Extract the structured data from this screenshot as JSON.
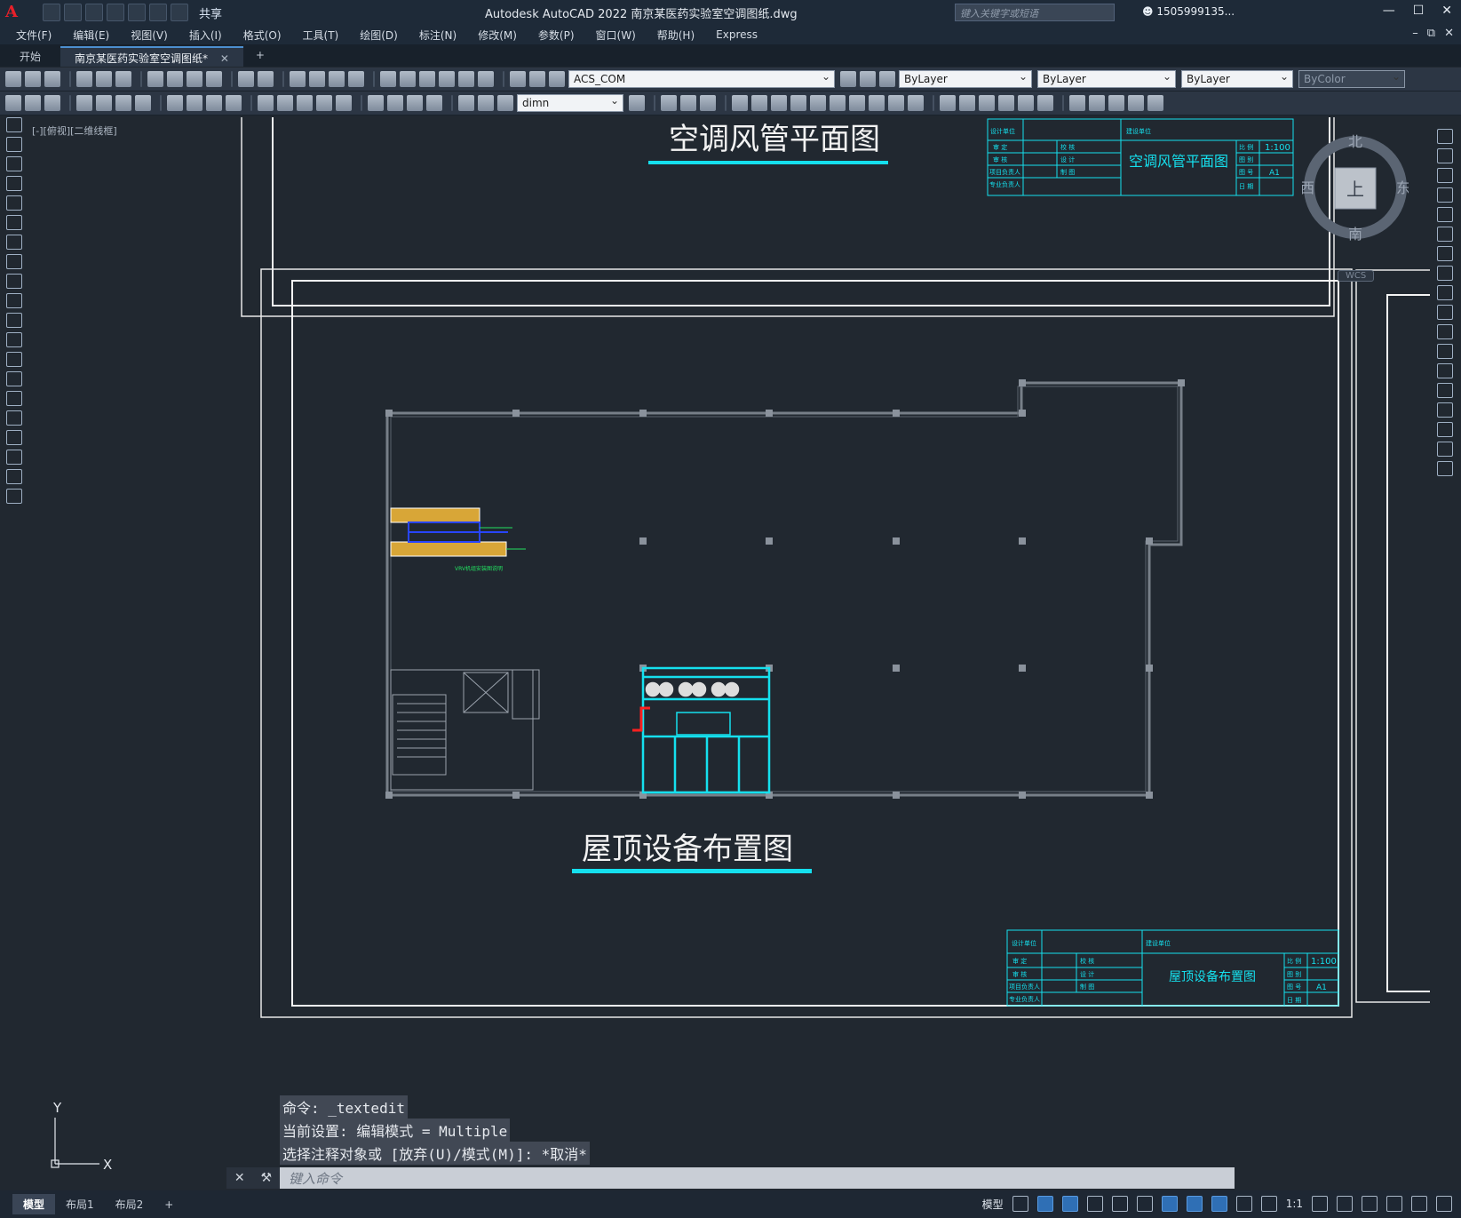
{
  "app": {
    "title": "Autodesk AutoCAD 2022    南京某医药实验室空调图纸.dwg",
    "logo": "A",
    "share_label": "共享",
    "search_placeholder": "键入关键字或短语",
    "user": "1505999135...",
    "window_controls": [
      "—",
      "☐",
      "✕"
    ]
  },
  "menu": {
    "items": [
      "文件(F)",
      "编辑(E)",
      "视图(V)",
      "插入(I)",
      "格式(O)",
      "工具(T)",
      "绘图(D)",
      "标注(N)",
      "修改(M)",
      "参数(P)",
      "窗口(W)",
      "帮助(H)",
      "Express"
    ],
    "mdi_controls": [
      "–",
      "⧉",
      "✕"
    ]
  },
  "tabs": {
    "start": "开始",
    "document": "南京某医药实验室空调图纸*",
    "close": "✕",
    "add": "+"
  },
  "toolbar": {
    "layer": "ACS_COM",
    "color": "ByLayer",
    "linetype": "ByLayer",
    "lineweight": "ByLayer",
    "plotstyle": "ByColor",
    "dimstyle": "dimn"
  },
  "viewport": {
    "label": "[-][俯视][二维线框]",
    "compass": {
      "north": "北",
      "south": "南",
      "east": "东",
      "west": "西",
      "top": "上"
    },
    "wcs": "WCS",
    "ucs_x": "X",
    "ucs_y": "Y"
  },
  "drawing": {
    "sheet1": {
      "title": "空调风管平面图",
      "tb_name": "空调风管平面图",
      "scale": "1:100",
      "size": "A1"
    },
    "sheet2": {
      "title": "屋顶设备布置图",
      "tb_name": "屋顶设备布置图",
      "scale": "1:100",
      "size": "A1",
      "vrv_note": "VRV机组安装图说明"
    },
    "titleblock_labels": {
      "design_unit": "设计单位",
      "owner": "建设单位",
      "approve": "审 定",
      "check": "审 核",
      "proofread": "校 核",
      "design": "设 计",
      "project_lead": "项目负责人",
      "draw": "制 图",
      "discipline_lead": "专业负责人",
      "scale_label": "比 例",
      "sheet_label": "图 别",
      "number_label": "图 号",
      "date_label": "日 期"
    }
  },
  "command": {
    "history": [
      "命令: _textedit",
      "当前设置: 编辑模式 = Multiple",
      "选择注释对象或 [放弃(U)/模式(M)]: *取消*"
    ],
    "prompt": "键入命令"
  },
  "status": {
    "layouts": [
      "模型",
      "布局1",
      "布局2"
    ],
    "add": "+",
    "model": "模型",
    "scale": "1:1"
  }
}
